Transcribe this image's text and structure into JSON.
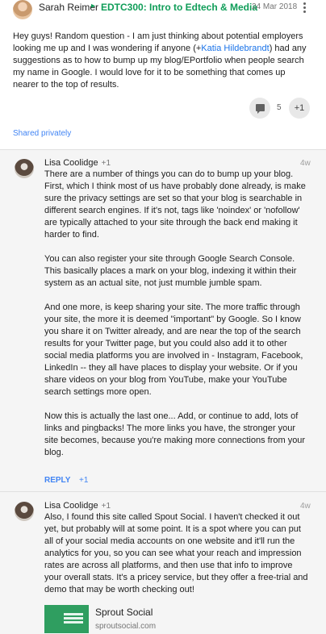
{
  "post": {
    "author": "Sarah Reimer",
    "community_arrow": "▸",
    "community": "EDTC300: Intro to Edtech & Media",
    "date": "24 Mar 2018",
    "text_before_mention": "Hey guys! Random question - I am just thinking about potential employers looking me up and I was wondering if anyone (+",
    "mention": "Katia Hildebrandt",
    "text_after_mention": ") had any suggestions as to how to bump up my blog/EPortfolio when people search my name in Google. I would love for it to be something that comes up nearer to the top of results.",
    "comment_count": "5",
    "plus_one": "+1",
    "visibility": "Shared privately"
  },
  "comments": [
    {
      "author": "Lisa Coolidge",
      "plus": "+1",
      "time": "4w",
      "paragraphs": [
        "There are a number of things you can do to bump up your blog. First, which I think most of us have probably done already, is make sure the privacy settings are set so that your blog is searchable in different search engines. If it's not, tags like 'noindex' or 'nofollow' are typically attached to your site through the back end making it harder to find.",
        "You can also register your site through Google Search Console. This basically places a mark on your blog, indexing it within their system as an actual site, not just mumble jumble spam.",
        "And one more, is keep sharing your site. The more traffic through your site, the more it is deemed \"important\" by Google. So I know you share it on Twitter already, and are near the top of the search results for your Twitter page, but you could also add it to other social media platforms you are involved in - Instagram, Facebook, LinkedIn -- they all have places to display your website. Or if you share videos on your blog from YouTube, make your YouTube search settings more open.",
        "Now this is actually the last one... Add, or continue to add, lots of links and pingbacks! The more links you have, the stronger your site becomes, because you're making more connections from your blog."
      ],
      "reply_label": "REPLY",
      "plus_one_label": "+1"
    },
    {
      "author": "Lisa Coolidge",
      "plus": "+1",
      "time": "4w",
      "paragraphs": [
        "Also, I found this site called Spout Social. I haven't checked it out yet, but probably will at some point. It is a spot where you can put all of your social media accounts on one website and it'll run the analytics for you, so you can see what your reach and impression rates are across all platforms, and then use that info to improve your overall stats. It's a pricey service, but they offer a free-trial and demo that may be worth checking out!"
      ],
      "link_card": {
        "title": "Sprout Social",
        "domain": "sproutsocial.com"
      }
    }
  ],
  "colors": {
    "community": "#0f9d58",
    "link": "#4285f4",
    "thread_bg": "#f5f5f5"
  },
  "icons": [
    "more-vert-icon",
    "comment-icon",
    "avatar"
  ]
}
